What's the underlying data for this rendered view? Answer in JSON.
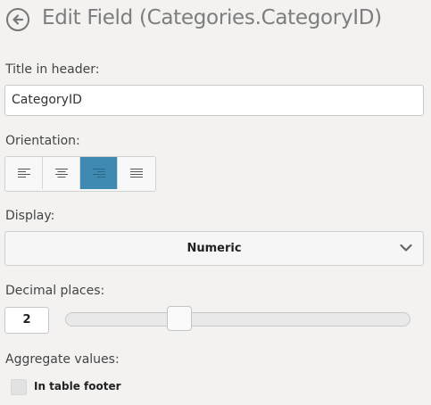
{
  "header": {
    "back_icon": "back-arrow-circle-icon",
    "title": "Edit Field (Categories.CategoryID)"
  },
  "title_in_header": {
    "label": "Title in header:",
    "value": "CategoryID"
  },
  "orientation": {
    "label": "Orientation:",
    "options": [
      {
        "icon": "align-left-icon",
        "selected": false
      },
      {
        "icon": "align-center-icon",
        "selected": false
      },
      {
        "icon": "align-right-icon",
        "selected": true
      },
      {
        "icon": "align-justify-icon",
        "selected": false
      }
    ],
    "accent_color": "#3f8ab2"
  },
  "display": {
    "label": "Display:",
    "selected": "Numeric",
    "arrow_icon": "chevron-down-icon"
  },
  "decimal_places": {
    "label": "Decimal places:",
    "value": "2",
    "slider_fraction": 0.35
  },
  "aggregate": {
    "label": "Aggregate values:",
    "checkbox_label": "In table footer",
    "checked": false
  }
}
